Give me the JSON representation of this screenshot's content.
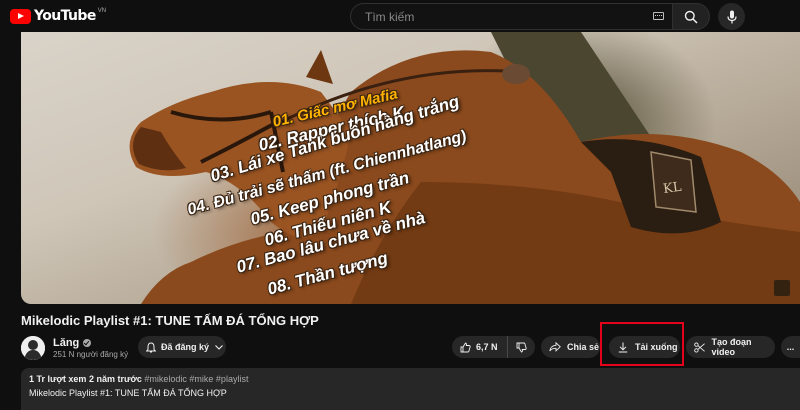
{
  "brand": {
    "logo_text": "YouTube",
    "country_code": "VN",
    "accent": "#ff0000"
  },
  "search": {
    "placeholder": "Tìm kiếm",
    "value": ""
  },
  "player": {
    "tracks": [
      "01. Giấc mơ Mafia",
      "02. Rapper thích K",
      "03. Lái xe Tank buôn hàng trắng",
      "04. Đủ trải sẽ thấm (ft. Chiennhatlang)",
      "05. Keep phong trần",
      "06. Thiếu niên K",
      "07. Bao lâu chưa về nhà",
      "08. Thần tượng"
    ],
    "saddle_monogram": "KL",
    "first_track_color": "#ffb300"
  },
  "video": {
    "title": "Mikelodic Playlist #1: TUNE TẤM ĐÁ TỔNG HỢP"
  },
  "channel": {
    "name": "Lăng",
    "subscribers": "251 N người đăng ký"
  },
  "actions": {
    "subscribed_label": "Đã đăng ký",
    "likes": "6,7 N",
    "share_label": "Chia sẻ",
    "download_label": "Tải xuống",
    "clip_label": "Tạo đoạn video",
    "more_label": "..."
  },
  "highlight_color": "#e3001b",
  "description": {
    "views": "1 Tr lượt xem",
    "age": "2 năm trước",
    "tags": "#mikelodic #mike #playlist",
    "text": "Mikelodic Playlist #1: TUNE TẤM ĐÁ TỔNG HỢP"
  }
}
